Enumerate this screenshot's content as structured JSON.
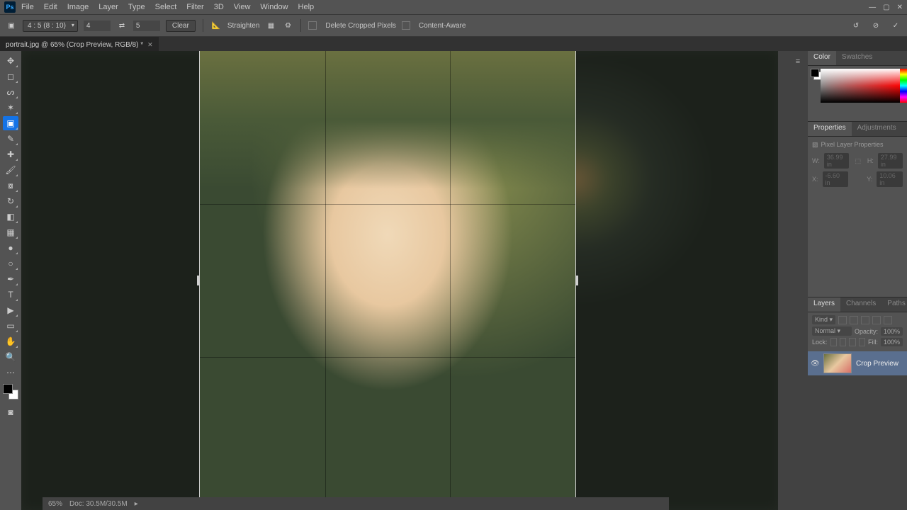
{
  "menubar": {
    "items": [
      "File",
      "Edit",
      "Image",
      "Layer",
      "Type",
      "Select",
      "Filter",
      "3D",
      "View",
      "Window",
      "Help"
    ],
    "logo": "Ps"
  },
  "optionbar": {
    "ratio": "4 : 5 (8 : 10)",
    "w": "4",
    "h": "5",
    "clear": "Clear",
    "straighten": "Straighten",
    "delete_cropped": "Delete Cropped Pixels",
    "content_aware": "Content-Aware"
  },
  "doctab": {
    "title": "portrait.jpg @ 65% (Crop Preview, RGB/8) *"
  },
  "tools": [
    "move",
    "marquee",
    "lasso",
    "wand",
    "crop",
    "eyedrop",
    "heal",
    "brush",
    "stamp",
    "history",
    "eraser",
    "gradient",
    "blur",
    "dodge",
    "pen",
    "type",
    "path",
    "shape",
    "hand",
    "zoom"
  ],
  "panels": {
    "color_tab": "Color",
    "swatches_tab": "Swatches",
    "properties_tab": "Properties",
    "adjustments_tab": "Adjustments",
    "pixel_layer": "Pixel Layer Properties",
    "prop_w": "W:",
    "prop_wv": "36.99 in",
    "prop_h": "H:",
    "prop_hv": "27.99 in",
    "prop_x": "X:",
    "prop_xv": "-6.60 in",
    "prop_y": "Y:",
    "prop_yv": "10.06 in",
    "layers_tab": "Layers",
    "channels_tab": "Channels",
    "paths_tab": "Paths",
    "kind": "Kind",
    "blend": "Normal",
    "opacity_label": "Opacity:",
    "opacity": "100%",
    "lock_label": "Lock:",
    "fill_label": "Fill:",
    "fill": "100%",
    "layer_name": "Crop Preview"
  },
  "status": {
    "zoom": "65%",
    "doc": "Doc: 30.5M/30.5M"
  }
}
